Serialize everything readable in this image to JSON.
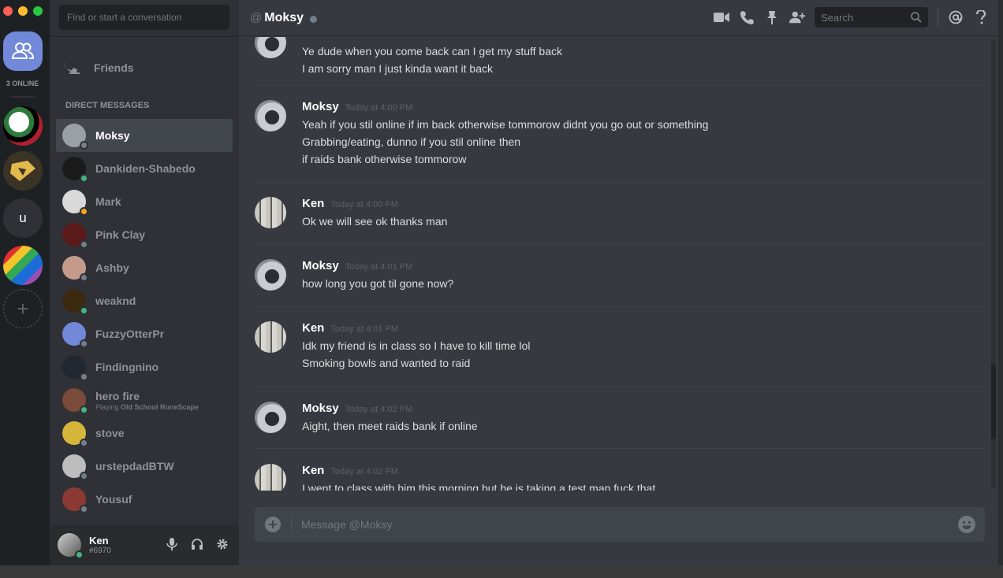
{
  "guilds": {
    "online_count": "3 ONLINE",
    "g3_letter": "u"
  },
  "sidebar": {
    "search_placeholder": "Find or start a conversation",
    "friends_label": "Friends",
    "dm_header": "DIRECT MESSAGES",
    "dms": [
      {
        "name": "Moksy",
        "status": "offline",
        "selected": true,
        "color": "#9aa0a6"
      },
      {
        "name": "Dankiden-Shabedo",
        "status": "online",
        "color": "#1b1b1b"
      },
      {
        "name": "Mark",
        "status": "idle",
        "color": "#d9d9d9"
      },
      {
        "name": "Pink Clay",
        "status": "offline",
        "color": "#5b1a1a"
      },
      {
        "name": "Ashby",
        "status": "offline",
        "color": "#c49b8b"
      },
      {
        "name": "weaknd",
        "status": "online",
        "color": "#3b2a10"
      },
      {
        "name": "FuzzyOtterPr",
        "status": "offline",
        "color": "#7289da"
      },
      {
        "name": "Findingnino",
        "status": "offline",
        "color": "#222831"
      },
      {
        "name": "hero fire",
        "status": "online",
        "sub_prefix": "Playing ",
        "sub_game": "Old School RuneScape",
        "color": "#7a4a3a"
      },
      {
        "name": "stove",
        "status": "offline",
        "color": "#d6b63a"
      },
      {
        "name": "urstepdadBTW",
        "status": "offline",
        "color": "#bdbdbd"
      },
      {
        "name": "Yousuf",
        "status": "offline",
        "color": "#8a3a32"
      }
    ]
  },
  "user": {
    "name": "Ken",
    "tag": "#6970",
    "status": "online"
  },
  "topbar": {
    "at": "@",
    "channel": "Moksy",
    "search_placeholder": "Search"
  },
  "messages": [
    {
      "author": "",
      "avatar": "moksy",
      "time": "",
      "lines": [
        "Ye dude when you come back can I get my stuff back",
        "I am sorry man I just kinda want it back"
      ]
    },
    {
      "author": "Moksy",
      "avatar": "moksy",
      "time": "Today at 4:00 PM",
      "lines": [
        "Yeah if you stil online if im back otherwise tommorow didnt you go out or something",
        "Grabbing/eating, dunno if you stil online then",
        "if raids bank otherwise tommorow"
      ]
    },
    {
      "author": "Ken",
      "avatar": "ken",
      "time": "Today at 4:00 PM",
      "lines": [
        "Ok we will see ok thanks man"
      ]
    },
    {
      "author": "Moksy",
      "avatar": "moksy",
      "time": "Today at 4:01 PM",
      "lines": [
        "how long you got til gone now?"
      ]
    },
    {
      "author": "Ken",
      "avatar": "ken",
      "time": "Today at 4:01 PM",
      "lines": [
        "Idk my friend is in class so I have to kill time lol",
        "Smoking bowls and wanted to raid"
      ]
    },
    {
      "author": "Moksy",
      "avatar": "moksy",
      "time": "Today at 4:02 PM",
      "lines": [
        "Aight, then meet raids bank if online"
      ]
    },
    {
      "author": "Ken",
      "avatar": "ken",
      "time": "Today at 4:02 PM",
      "lines": [
        "I went to class with him this morning but he is taking a test man fuck that"
      ]
    }
  ],
  "composer": {
    "placeholder": "Message @Moksy"
  },
  "colors": {
    "accent": "#7289da",
    "online": "#43b581",
    "idle": "#faa61a",
    "offline": "#747f8d"
  }
}
